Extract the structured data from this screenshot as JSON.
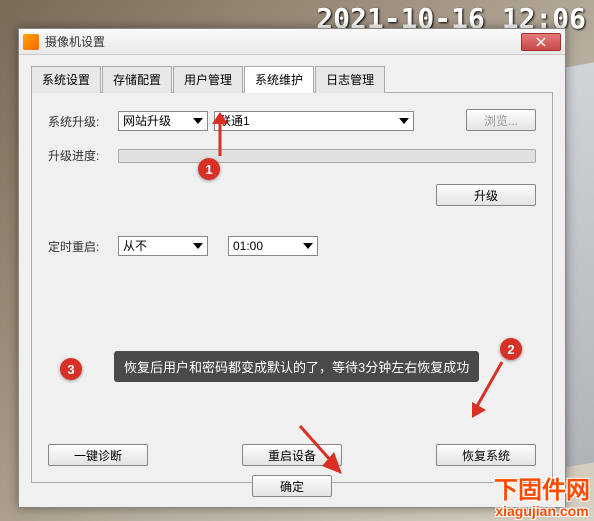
{
  "timestamp": "2021-10-16 12:06",
  "dialog": {
    "title": "摄像机设置"
  },
  "tabs": [
    "系统设置",
    "存储配置",
    "用户管理",
    "系统维护",
    "日志管理"
  ],
  "active_tab_index": 3,
  "maintenance": {
    "upgrade_label": "系统升级:",
    "upgrade_method": "网站升级",
    "upgrade_channel": "联通1",
    "browse_label": "浏览...",
    "progress_label": "升级进度:",
    "upgrade_btn": "升级",
    "reboot_label": "定时重启:",
    "reboot_freq": "从不",
    "reboot_time": "01:00",
    "diagnose_btn": "一键诊断",
    "reboot_btn": "重启设备",
    "restore_btn": "恢复系统",
    "ok_btn": "确定"
  },
  "annotations": {
    "marker1": "1",
    "marker2": "2",
    "marker3": "3",
    "tooltip": "恢复后用户和密码都变成默认的了，等待3分钟左右恢复成功"
  },
  "watermark": {
    "cn": "下固件网",
    "en": "xiagujian.com"
  },
  "colors": {
    "marker": "#d93025",
    "watermark": "#ff4800"
  }
}
